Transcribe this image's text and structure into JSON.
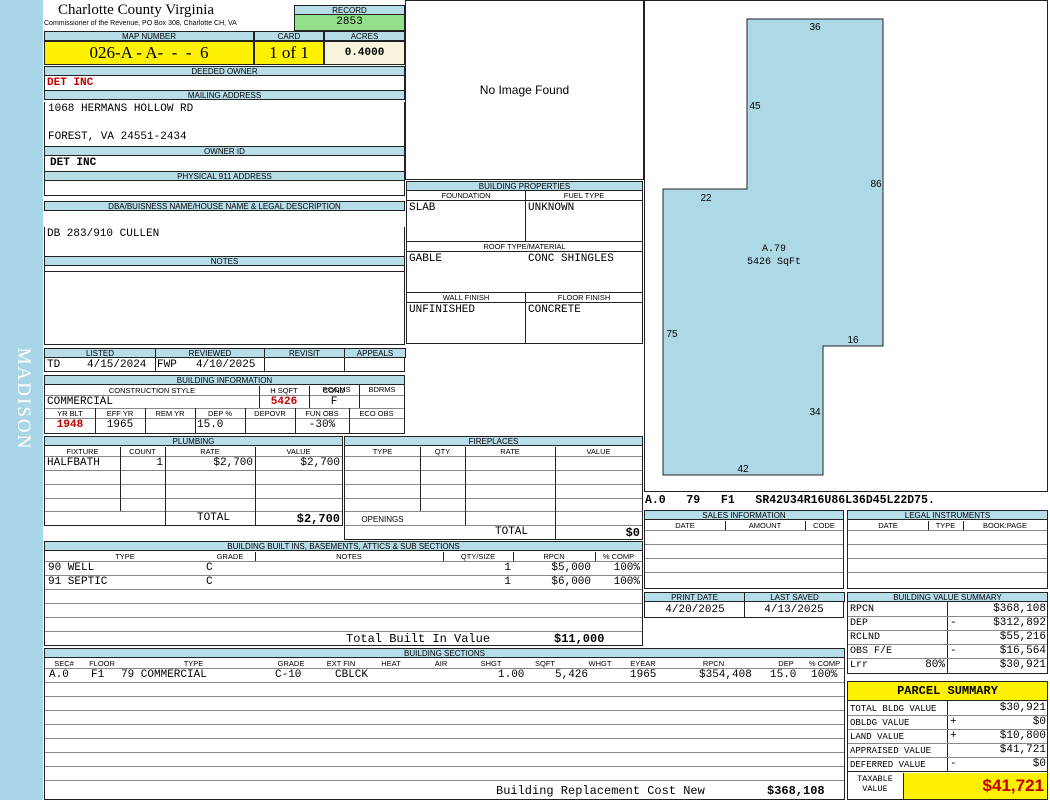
{
  "side_label": "MADISON",
  "header": {
    "county": "Charlotte County Virginia",
    "commissioner": "Commissioner of the Revenue, PO Box 308, Charlotte CH, VA",
    "record_label": "RECORD",
    "record": "2853",
    "map_number_label": "MAP NUMBER",
    "map_number": "026-A - A-  -  -  6",
    "card_label": "CARD",
    "card": "1 of 1",
    "acres_label": "ACRES",
    "acres": "0.4000"
  },
  "owner": {
    "deeded_owner_label": "DEEDED OWNER",
    "deeded_owner": "DET INC",
    "mailing_label": "MAILING ADDRESS",
    "mailing_line1": "1068 HERMANS HOLLOW RD",
    "mailing_line2": "FOREST, VA 24551-2434",
    "owner_id_label": "OWNER ID",
    "owner_id": "DET INC",
    "physical_label": "PHYSICAL 911 ADDRESS",
    "physical": "",
    "legal_label": "DBA/BUISNESS NAME/HOUSE NAME & LEGAL DESCRIPTION",
    "legal": "DB 283/910 CULLEN",
    "notes_label": "NOTES",
    "notes": ""
  },
  "image_panel": {
    "text": "No Image Found"
  },
  "building_properties": {
    "title": "BUILDING PROPERTIES",
    "foundation_label": "FOUNDATION",
    "fuel_label": "FUEL TYPE",
    "foundation": "SLAB",
    "fuel": "UNKNOWN",
    "roof_label": "ROOF TYPE/MATERIAL",
    "roof_type": "GABLE",
    "roof_material": "CONC SHINGLES",
    "wall_label": "WALL FINISH",
    "floor_label": "FLOOR FINISH",
    "wall": "UNFINISHED",
    "floor": "CONCRETE"
  },
  "listing": {
    "listed_label": "LISTED",
    "reviewed_label": "REVIEWED",
    "revisit_label": "REVISIT",
    "appeals_label": "APPEALS",
    "listed_by": "TD",
    "listed_date": "4/15/2024",
    "reviewed_by": "FWP",
    "reviewed_date": "4/10/2025"
  },
  "building_info": {
    "title": "BUILDING INFORMATION",
    "style_label": "CONSTRUCTION STYLE",
    "hsqft_label": "H SQFT",
    "cond_label": "COND",
    "rooms_label": "ROOMS",
    "bdrms_label": "BDRMS",
    "style": "COMMERCIAL",
    "hsqft": "5426",
    "cond": "F",
    "yrblt_label": "YR BLT",
    "effyr_label": "EFF YR",
    "remyr_label": "REM YR",
    "dep_label": "DEP %",
    "depovr_label": "DEPOVR",
    "funobs_label": "FUN OBS",
    "ecoobs_label": "ECO OBS",
    "yrblt": "1948",
    "effyr": "1965",
    "dep": "15.0",
    "funobs": "-30%"
  },
  "plumbing": {
    "title": "PLUMBING",
    "columns": [
      "FIXTURE",
      "COUNT",
      "RATE",
      "VALUE"
    ],
    "rows": [
      {
        "fixture": "HALFBATH",
        "count": "1",
        "rate": "$2,700",
        "value": "$2,700"
      }
    ],
    "total_label": "TOTAL",
    "total": "$2,700"
  },
  "fireplaces": {
    "title": "FIREPLACES",
    "columns": [
      "TYPE",
      "QTY",
      "RATE",
      "VALUE"
    ],
    "openings_label": "OPENINGS",
    "total_label": "TOTAL",
    "total": "$0"
  },
  "built_ins": {
    "title": "BUILDING BUILT INS, BASEMENTS, ATTICS & SUB SECTIONS",
    "columns": [
      "TYPE",
      "GRADE",
      "NOTES",
      "QTY/SIZE",
      "RPCN",
      "% COMP"
    ],
    "rows": [
      {
        "type": "90 WELL",
        "grade": "C",
        "qty": "1",
        "rpcn": "$5,000",
        "comp": "100%"
      },
      {
        "type": "91 SEPTIC",
        "grade": "C",
        "qty": "1",
        "rpcn": "$6,000",
        "comp": "100%"
      }
    ],
    "total_label": "Total Built In Value",
    "total": "$11,000"
  },
  "sections": {
    "title": "BUILDING SECTIONS",
    "columns": [
      "SEC#",
      "FLOOR",
      "TYPE",
      "GRADE",
      "EXT FIN",
      "HEAT",
      "AIR",
      "SHGT",
      "SQFT",
      "WHGT",
      "EYEAR",
      "RPCN",
      "DEP",
      "% COMP"
    ],
    "rows": [
      {
        "sec": "A.0",
        "floor": "F1",
        "type": "79 COMMERCIAL",
        "grade": "C-10",
        "extfin": "CBLCK",
        "shgt": "1.00",
        "sqft": "5,426",
        "eyear": "1965",
        "rpcn": "$354,408",
        "dep": "15.0",
        "comp": "100%"
      }
    ],
    "rcn_label": "Building Replacement Cost New",
    "rcn": "$368,108"
  },
  "sketch": {
    "labels": [
      "36",
      "45",
      "86",
      "22",
      "75",
      "16",
      "34",
      "42"
    ],
    "area_name": "A.79",
    "area_sqft": "5426 SqFt",
    "vector": "A.0   79   F1   SR42U34R16U86L36D45L22D75."
  },
  "sales": {
    "title": "SALES INFORMATION",
    "columns": [
      "DATE",
      "AMOUNT",
      "CODE"
    ]
  },
  "legal_instruments": {
    "title": "LEGAL INSTRUMENTS",
    "columns": [
      "DATE",
      "TYPE",
      "BOOK:PAGE"
    ]
  },
  "dates": {
    "print_label": "PRINT DATE",
    "saved_label": "LAST SAVED",
    "print_date": "4/20/2025",
    "last_saved": "4/13/2025"
  },
  "value_summary": {
    "title": "BUILDING VALUE SUMMARY",
    "rows": [
      {
        "label": "RPCN",
        "sign": "",
        "pct": "",
        "value": "$368,108"
      },
      {
        "label": "DEP",
        "sign": "-",
        "pct": "",
        "value": "$312,892"
      },
      {
        "label": "RCLND",
        "sign": "",
        "pct": "",
        "value": "$55,216"
      },
      {
        "label": "OBS F/E",
        "sign": "-",
        "pct": "",
        "value": "$16,564"
      },
      {
        "label": "Lrr",
        "sign": "",
        "pct": "80%",
        "value": "$30,921"
      }
    ]
  },
  "parcel_summary": {
    "title": "PARCEL SUMMARY",
    "rows": [
      {
        "label": "TOTAL BLDG VALUE",
        "sign": "",
        "value": "$30,921"
      },
      {
        "label": "OBLDG VALUE",
        "sign": "+",
        "value": "$0"
      },
      {
        "label": "LAND VALUE",
        "sign": "+",
        "value": "$10,800"
      },
      {
        "label": "APPRAISED VALUE",
        "sign": "",
        "value": "$41,721"
      },
      {
        "label": "DEFERRED VALUE",
        "sign": "-",
        "value": "$0"
      }
    ],
    "taxable_label": "TAXABLE VALUE",
    "taxable": "$41,721"
  }
}
